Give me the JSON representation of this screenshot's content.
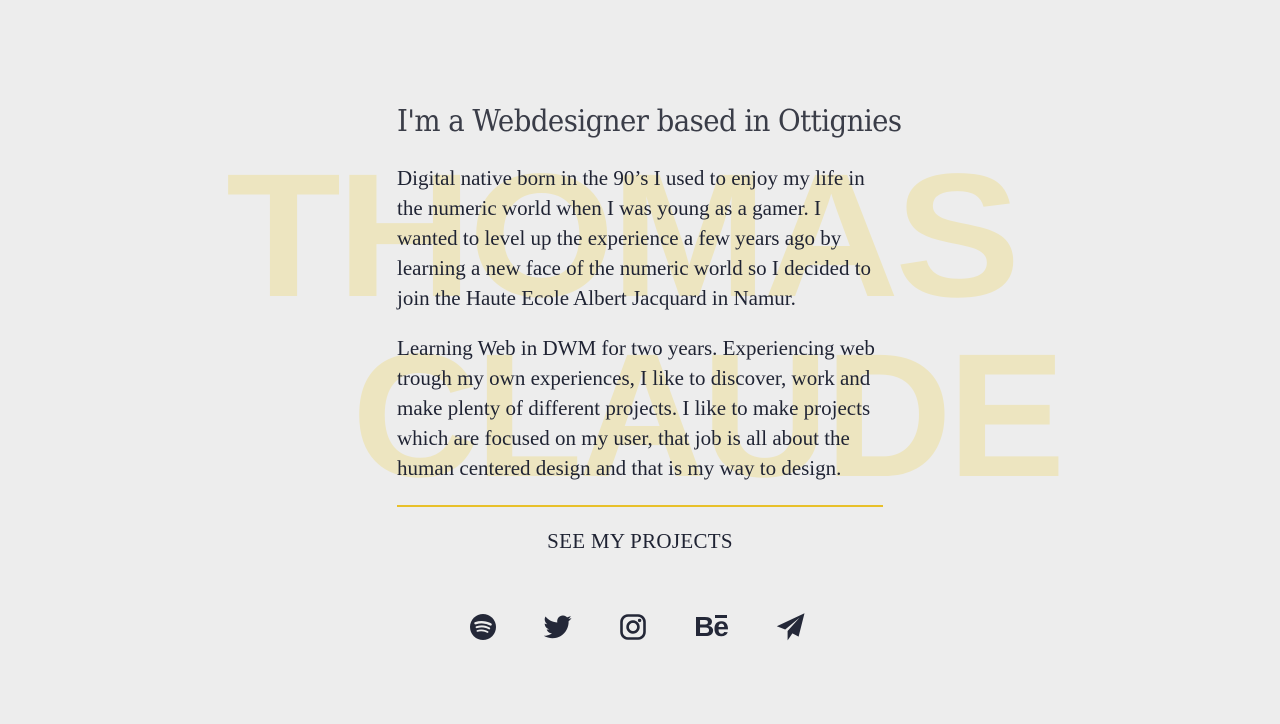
{
  "background_name": {
    "first": "THOMAS",
    "last": "CLAUDE"
  },
  "intro": {
    "headline": "I'm a Webdesigner based in Ottignies",
    "paragraphs": [
      "Digital native born in the 90’s I used to enjoy my life in the numeric world when I was young as a gamer. I wanted to level up the experience a few years ago by learning a new face of the numeric world so I decided to join the Haute Ecole Albert Jacquard in Namur.",
      "Learning Web in DWM for two years. Experiencing web trough my own experiences, I like to discover, work and make plenty of different projects. I like to make projects which are focused on my user, that job is all about the human centered design and that is my way to design."
    ]
  },
  "cta": {
    "label": "SEE MY PROJECTS"
  },
  "socials": [
    {
      "name": "spotify",
      "icon": "spotify-icon"
    },
    {
      "name": "twitter",
      "icon": "twitter-icon"
    },
    {
      "name": "instagram",
      "icon": "instagram-icon"
    },
    {
      "name": "behance",
      "icon": "behance-icon",
      "glyph": "Be"
    },
    {
      "name": "telegram",
      "icon": "paper-plane-icon"
    }
  ],
  "colors": {
    "background": "#ededed",
    "text": "#1f2333",
    "accent": "#e8c02a",
    "watermark": "#ede5c0"
  }
}
